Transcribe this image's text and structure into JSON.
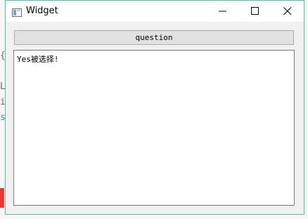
{
  "window": {
    "title": "Widget"
  },
  "main": {
    "button_label": "question",
    "text_content": "Yes被选择!"
  },
  "background": {
    "fragments": [
      "{",
      "L",
      "i",
      "s"
    ]
  },
  "colors": {
    "window_border": "#4fc39a",
    "button_bg": "#e1e1e1",
    "text_area_bg": "#ffffff"
  }
}
